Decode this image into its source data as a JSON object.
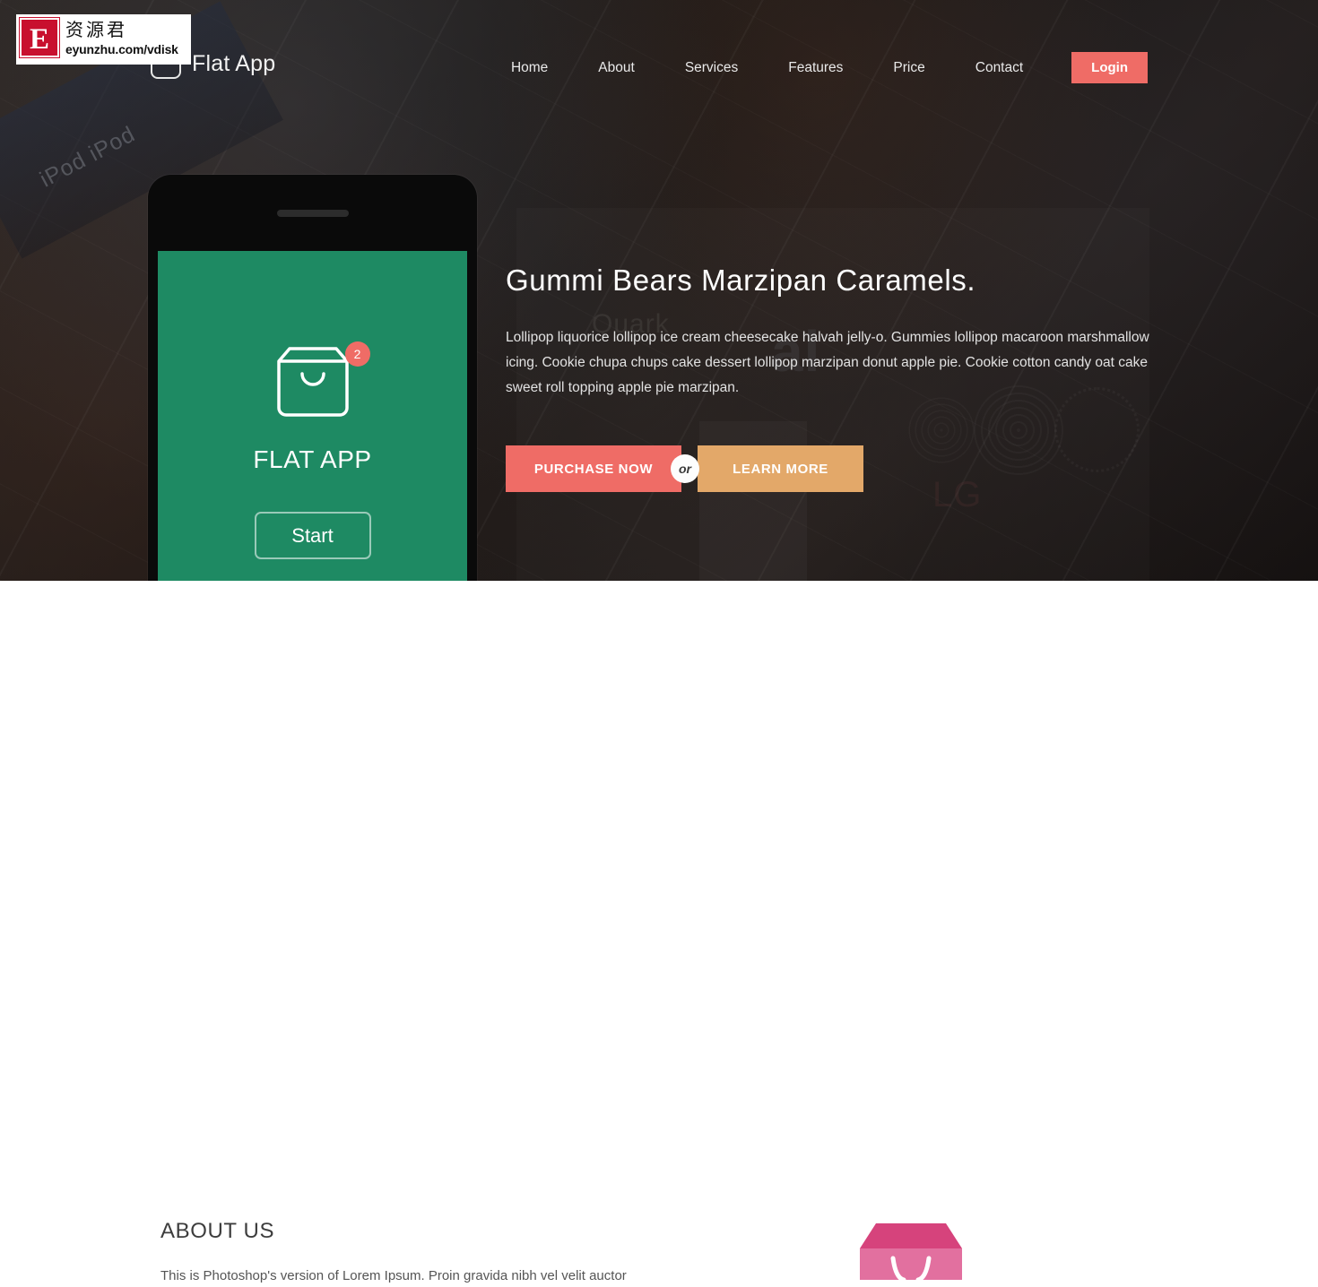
{
  "header": {
    "brand_name": "Flat App",
    "brand_icon": "shopping-bag-outline-icon",
    "nav": [
      {
        "label": "Home"
      },
      {
        "label": "About"
      },
      {
        "label": "Services"
      },
      {
        "label": "Features"
      },
      {
        "label": "Price"
      },
      {
        "label": "Contact"
      }
    ],
    "login_label": "Login",
    "login_color": "#ef6c66"
  },
  "hero": {
    "heading": "Gummi Bears Marzipan Caramels.",
    "paragraph": "Lollipop liquorice lollipop ice cream cheesecake halvah jelly-o. Gummies lollipop macaroon marshmallow icing. Cookie chupa chups cake dessert lollipop marzipan donut apple pie. Cookie cotton candy oat cake sweet roll topping apple pie marzipan.",
    "purchase_label": "PURCHASE NOW",
    "or_label": "or",
    "learn_label": "LEARN MORE",
    "purchase_color": "#ef6c66",
    "learn_color": "#e3a869",
    "background_words": {
      "ipod": "iPod  iPod",
      "quark": "Quark",
      "al": "al",
      "lg": "LG"
    }
  },
  "phone": {
    "screen_color": "#1e8a63",
    "app_icon": "shopping-bag-icon",
    "badge_count": "2",
    "badge_color": "#ef6c66",
    "app_title": "FLAT APP",
    "start_label": "Start"
  },
  "about": {
    "title": "ABOUT US",
    "text": "This is Photoshop's version of Lorem Ipsum. Proin gravida nibh vel velit auctor",
    "illustration": "pink-shopping-bag-illustration",
    "illustration_color": "#e2608f"
  },
  "watermark": {
    "logo_letter": "E",
    "chinese_text": "资源君",
    "url": "eyunzhu.com/vdisk",
    "logo_color": "#c8102e"
  }
}
